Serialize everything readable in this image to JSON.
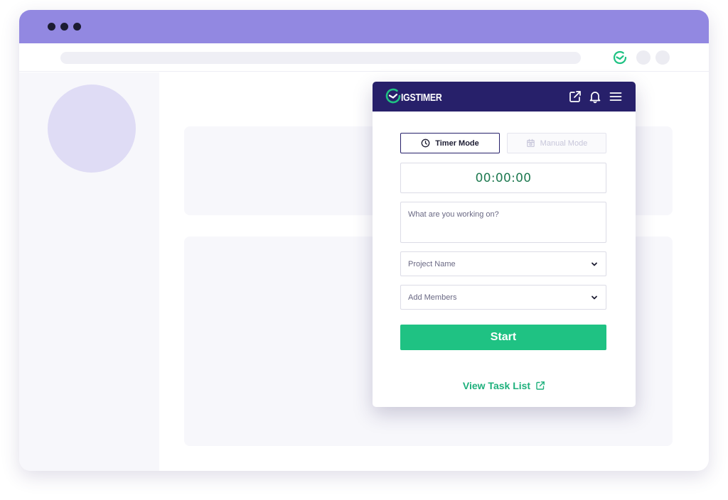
{
  "extension": {
    "brand": "IGSTIMER",
    "modes": {
      "timer_label": "Timer Mode",
      "manual_label": "Manual Mode"
    },
    "timer_value": "00:00:00",
    "task_placeholder": "What are you working on?",
    "project_select_label": "Project Name",
    "members_select_label": "Add Members",
    "start_label": "Start",
    "task_list_link": "View Task List"
  },
  "icons": {
    "toolbar_extension": "timer-clock-icon",
    "header": [
      "external-link-icon",
      "bell-icon",
      "menu-icon"
    ],
    "timer_mode": "clock-icon",
    "manual_mode": "calendar-icon",
    "dropdown": "chevron-down-icon",
    "task_list": "external-link-icon"
  },
  "colors": {
    "browser_titlebar": "#9288e1",
    "popup_header": "#27206a",
    "accent_green": "#1fc283",
    "timer_text": "#1f7a51"
  }
}
